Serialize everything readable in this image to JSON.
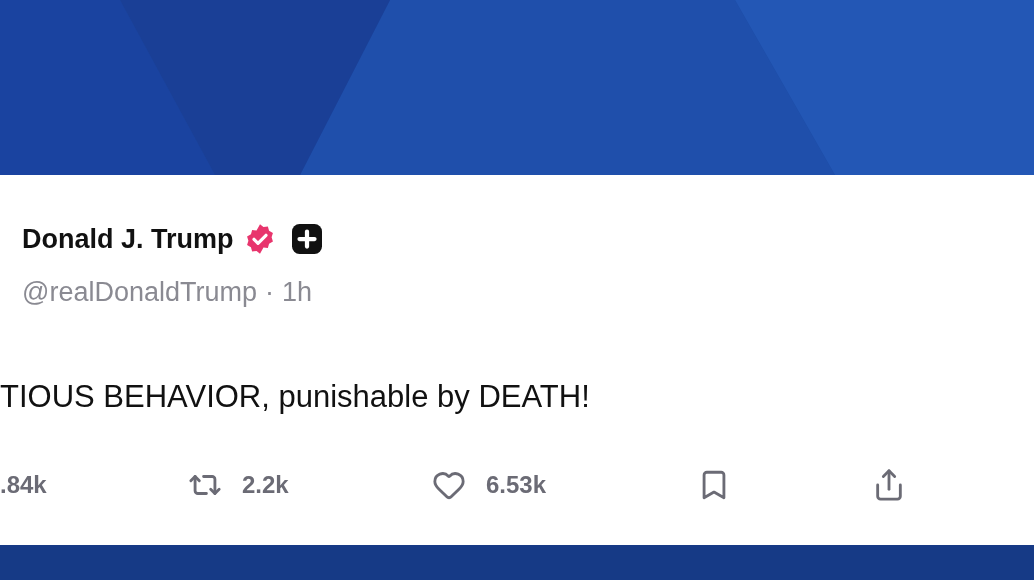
{
  "post": {
    "author": "Donald J. Trump",
    "verified": true,
    "handle": "@realDonaldTrump",
    "separator": "·",
    "time": "1h",
    "text": "TIOUS BEHAVIOR, punishable by DEATH!"
  },
  "actions": [
    {
      "kind": "reply",
      "count": ".84k"
    },
    {
      "kind": "repost",
      "count": "2.2k"
    },
    {
      "kind": "like",
      "count": "6.53k"
    },
    {
      "kind": "bookmark"
    },
    {
      "kind": "share"
    }
  ]
}
